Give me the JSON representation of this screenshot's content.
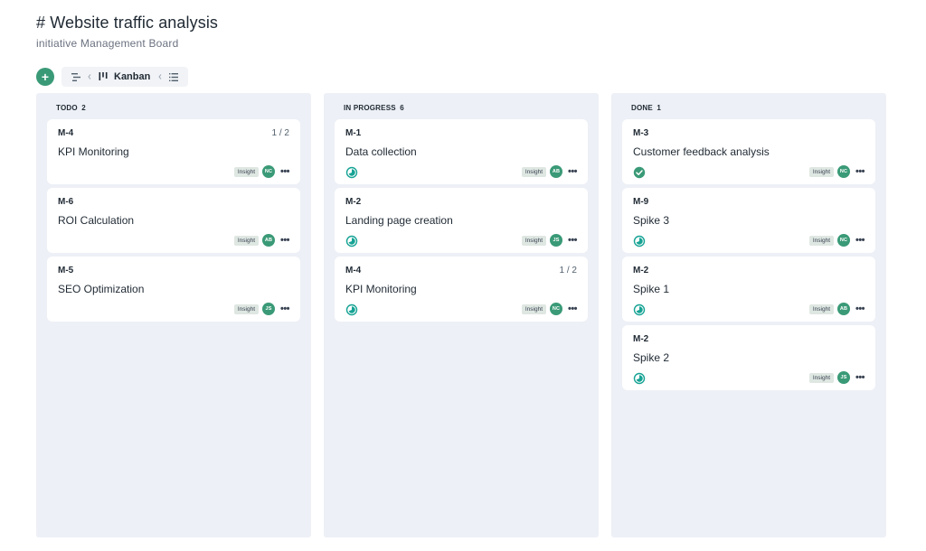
{
  "header": {
    "title": "# Website traffic analysis",
    "subtitle": "initiative Management Board"
  },
  "toolbar": {
    "add_icon": "plus-icon",
    "view_label": "Kanban",
    "icons": [
      "timeline-icon",
      "kanban-icon",
      "list-icon"
    ]
  },
  "colors": {
    "accent": "#3a9a77",
    "column_bg": "#edf0f6",
    "tag_bg": "#dfe7e2",
    "status_teal": "#16a394"
  },
  "columns": [
    {
      "title": "TODO",
      "count": "2",
      "cards": [
        {
          "id": "M-4",
          "title": "KPI Monitoring",
          "progress": "1 / 2",
          "status": "",
          "tag": "Insight",
          "avatar": "NC"
        },
        {
          "id": "M-6",
          "title": "ROI Calculation",
          "progress": "",
          "status": "",
          "tag": "Insight",
          "avatar": "AB"
        },
        {
          "id": "M-5",
          "title": "SEO Optimization",
          "progress": "",
          "status": "",
          "tag": "Insight",
          "avatar": "JS"
        }
      ]
    },
    {
      "title": "IN PROGRESS",
      "count": "6",
      "cards": [
        {
          "id": "M-1",
          "title": "Data collection",
          "progress": "",
          "status": "in-progress-icon",
          "tag": "Insight",
          "avatar": "AB"
        },
        {
          "id": "M-2",
          "title": "Landing page creation",
          "progress": "",
          "status": "in-progress-icon",
          "tag": "Insight",
          "avatar": "JS"
        },
        {
          "id": "M-4",
          "title": "KPI Monitoring",
          "progress": "1 / 2",
          "status": "in-progress-icon",
          "tag": "Insight",
          "avatar": "NC"
        }
      ]
    },
    {
      "title": "DONE",
      "count": "1",
      "cards": [
        {
          "id": "M-3",
          "title": "Customer feedback analysis",
          "progress": "",
          "status": "done-check-icon",
          "tag": "Insight",
          "avatar": "NC"
        },
        {
          "id": "M-9",
          "title": "Spike 3",
          "progress": "",
          "status": "in-progress-icon",
          "tag": "Insight",
          "avatar": "NC"
        },
        {
          "id": "M-2",
          "title": "Spike 1",
          "progress": "",
          "status": "in-progress-icon",
          "tag": "Insight",
          "avatar": "AB"
        },
        {
          "id": "M-2",
          "title": "Spike 2",
          "progress": "",
          "status": "in-progress-icon",
          "tag": "Insight",
          "avatar": "JS"
        }
      ]
    }
  ]
}
